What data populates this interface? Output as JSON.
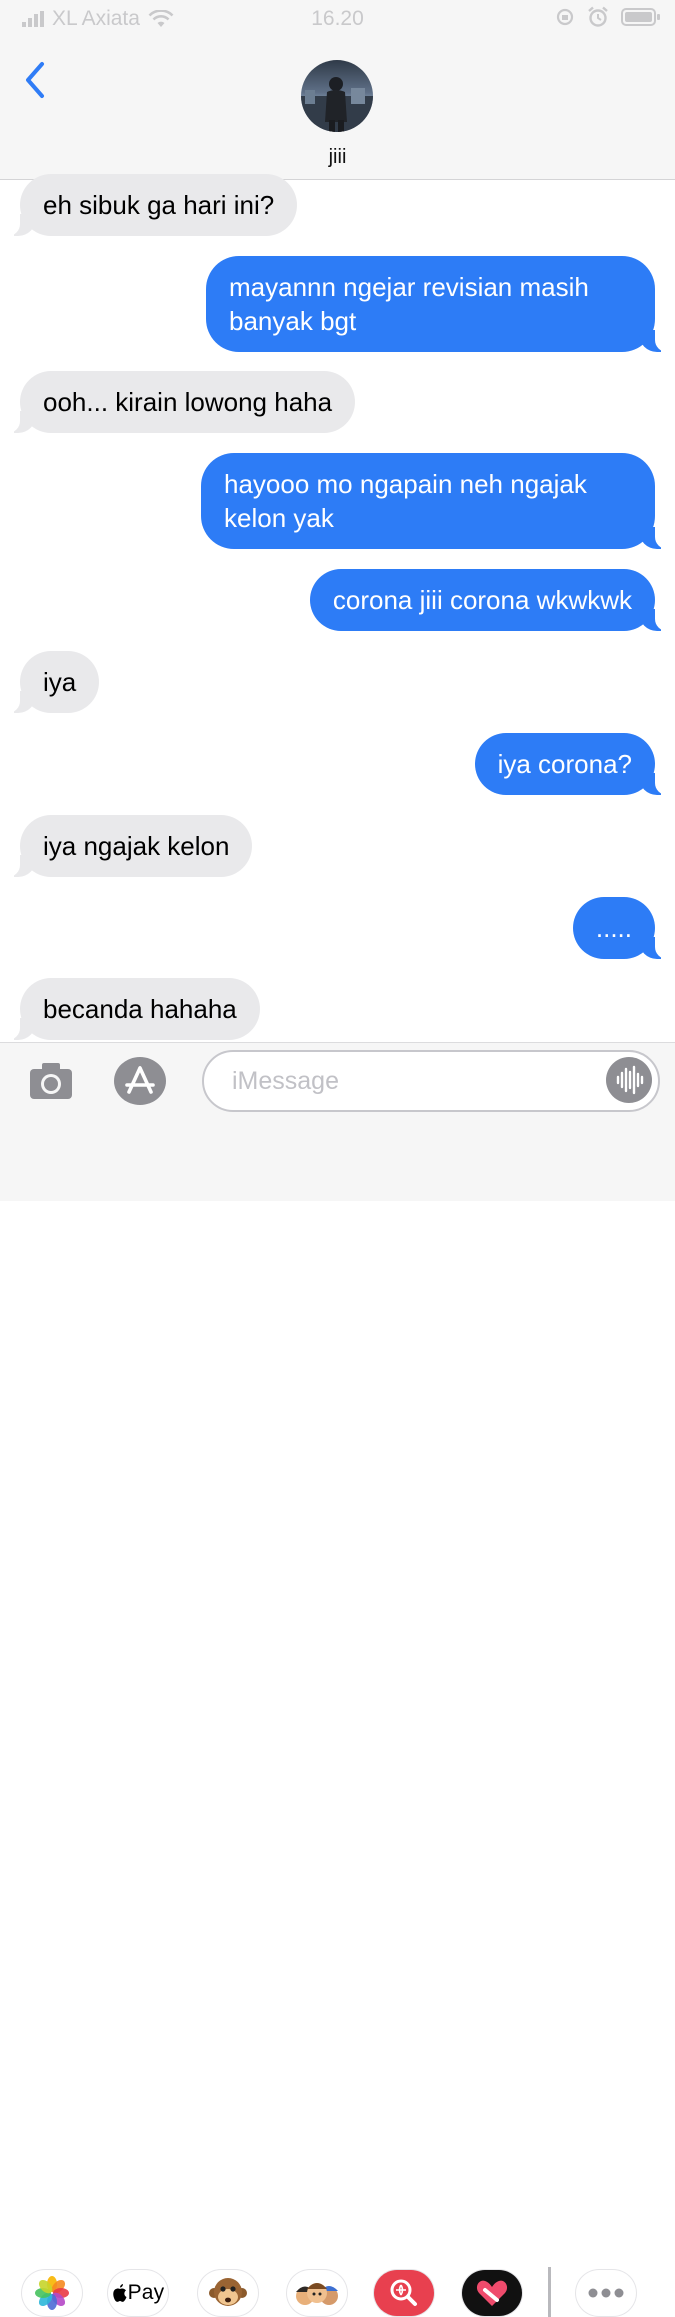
{
  "status_bar": {
    "carrier": "XL Axiata",
    "time": "16.20"
  },
  "header": {
    "contact_name": "jiii"
  },
  "messages": [
    {
      "from": "them",
      "text": "eh sibuk ga hari ini?"
    },
    {
      "from": "me",
      "line1": "mayannn ngejar revisian masih",
      "line2": "banyak bgt"
    },
    {
      "from": "them",
      "text": "ooh... kirain lowong haha"
    },
    {
      "from": "me",
      "line1": "hayooo mo ngapain neh ngajak",
      "line2": "kelon yak"
    },
    {
      "from": "me",
      "text": "corona jiii corona wkwkwk"
    },
    {
      "from": "them",
      "text": "iya"
    },
    {
      "from": "me",
      "text": "iya corona?"
    },
    {
      "from": "them",
      "text": "iya ngajak kelon"
    },
    {
      "from": "me",
      "text": "....."
    },
    {
      "from": "them",
      "text": "becanda hahaha"
    }
  ],
  "compose": {
    "placeholder": "iMessage"
  },
  "app_drawer": {
    "items": [
      "photos-app-icon",
      "apple-pay-icon",
      "monkey-memoji-icon",
      "memoji-stickers-icon",
      "web-search-icon",
      "digital-touch-icon",
      "more-icon"
    ],
    "apple_pay_label": "Pay"
  },
  "colors": {
    "sent_bubble": "#2d7cf6",
    "received_bubble": "#e9e9eb",
    "accent": "#2f7cf6"
  }
}
